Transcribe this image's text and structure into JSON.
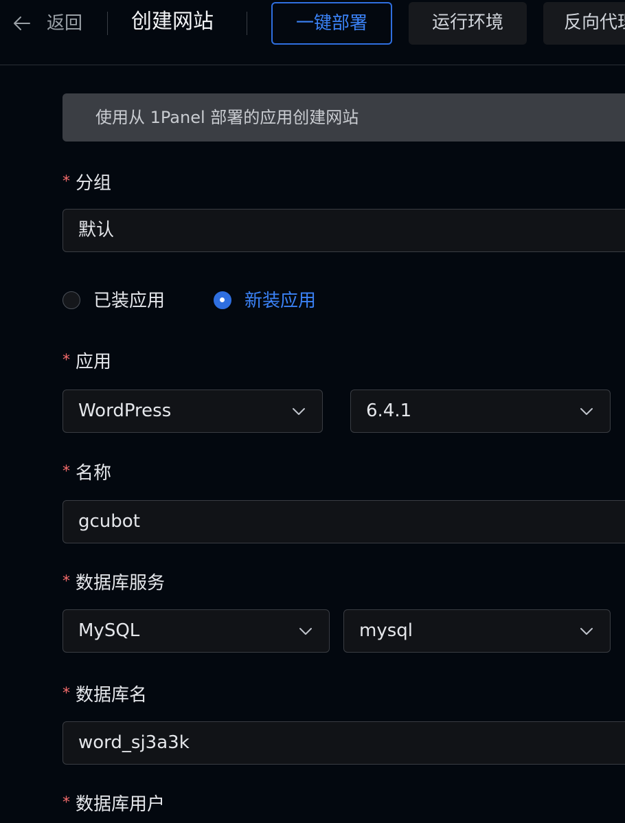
{
  "header": {
    "back_label": "返回",
    "title": "创建网站",
    "tabs": [
      {
        "label": "一键部署",
        "active": true
      },
      {
        "label": "运行环境",
        "active": false
      },
      {
        "label": "反向代理",
        "active": false
      }
    ]
  },
  "banner": {
    "text": "使用从 1Panel 部署的应用创建网站"
  },
  "form": {
    "group": {
      "label": "分组",
      "value": "默认"
    },
    "app_source": {
      "options": [
        {
          "label": "已装应用",
          "selected": false
        },
        {
          "label": "新装应用",
          "selected": true
        }
      ]
    },
    "app": {
      "label": "应用",
      "name_value": "WordPress",
      "version_value": "6.4.1"
    },
    "name": {
      "label": "名称",
      "value": "gcubot"
    },
    "db_service": {
      "label": "数据库服务",
      "type_value": "MySQL",
      "instance_value": "mysql"
    },
    "db_name": {
      "label": "数据库名",
      "value": "word_sj3a3k"
    },
    "db_user": {
      "label": "数据库用户"
    }
  },
  "colors": {
    "background": "#03080f",
    "accent": "#2f6fe0",
    "required": "#f56c6c"
  },
  "icons": {
    "back": "arrow-left-icon",
    "select": "chevron-down-icon"
  }
}
